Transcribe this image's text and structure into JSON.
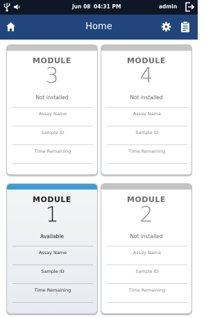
{
  "statusbar": {
    "date": "Jun 08",
    "time": "04:31 PM",
    "user": "admin",
    "icons": [
      "usb-icon",
      "speaker-icon",
      "logout-icon"
    ]
  },
  "appbar": {
    "title": "Home",
    "icons": [
      "home-icon",
      "gear-icon",
      "clipboard-icon"
    ]
  },
  "modules": [
    {
      "label": "MODULE",
      "number": "3",
      "status": "Not installed",
      "fields": [
        "Assay Name",
        "Sample ID",
        "Time Remaining"
      ]
    },
    {
      "label": "MODULE",
      "number": "4",
      "status": "Not installed",
      "fields": [
        "Assay Name",
        "Sample ID",
        "Time Remaining"
      ]
    },
    {
      "label": "MODULE",
      "number": "1",
      "status": "Available",
      "fields": [
        "Assay Name",
        "Sample ID",
        "Time Remaining"
      ]
    },
    {
      "label": "MODULE",
      "number": "2",
      "status": "Not installed",
      "fields": [
        "Assay Name",
        "Sample ID",
        "Time Remaining"
      ]
    }
  ],
  "colors": {
    "statusbar": "#0d1726",
    "appbar": "#22457d",
    "available_band": "#3d9dd3",
    "inactive_band": "#c4c4c4"
  }
}
